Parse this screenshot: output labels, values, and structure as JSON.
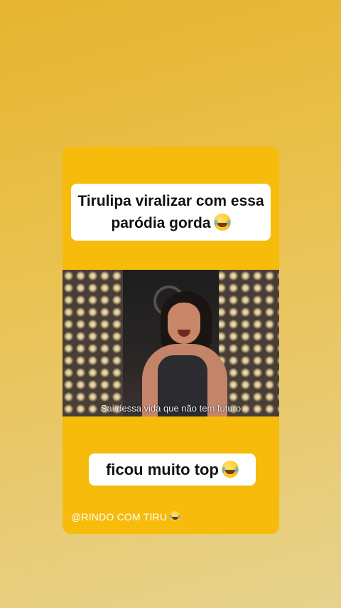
{
  "post": {
    "caption_top": "Tirulipa viralizar com essa paródia gorda",
    "caption_top_emoji": "face-with-tears-of-joy",
    "video_subtitle": "Sai dessa vida que não tem futuro",
    "caption_bottom": "ficou muito top",
    "caption_bottom_emoji": "face-with-tears-of-joy",
    "handle": "@RINDO COM TIRU",
    "handle_emoji": "face-with-tears-of-joy"
  },
  "colors": {
    "card_background": "#f6bb0b",
    "page_gradient_top": "#e6b530",
    "page_gradient_bottom": "#e6d28c",
    "caption_box": "#ffffff"
  }
}
